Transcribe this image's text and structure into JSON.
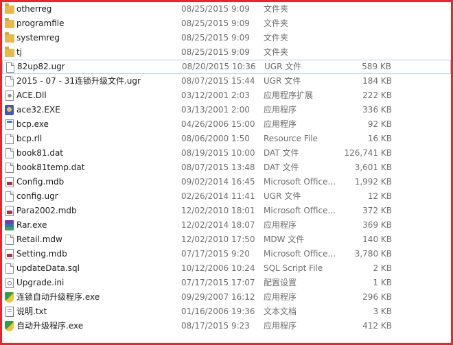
{
  "files": [
    {
      "name": "otherreg",
      "date": "08/25/2015 9:09",
      "type": "文件夹",
      "size": "",
      "icon": "folder-icon",
      "selected": false
    },
    {
      "name": "programfile",
      "date": "08/25/2015 9:09",
      "type": "文件夹",
      "size": "",
      "icon": "folder-icon",
      "selected": false
    },
    {
      "name": "systemreg",
      "date": "08/25/2015 9:09",
      "type": "文件夹",
      "size": "",
      "icon": "folder-icon",
      "selected": false
    },
    {
      "name": "tj",
      "date": "08/25/2015 9:09",
      "type": "文件夹",
      "size": "",
      "icon": "folder-icon",
      "selected": false
    },
    {
      "name": "82up82.ugr",
      "date": "08/20/2015 10:36",
      "type": "UGR 文件",
      "size": "589 KB",
      "icon": "document-icon",
      "selected": true
    },
    {
      "name": "2015 - 07 - 31连锁升级文件.ugr",
      "date": "08/07/2015 15:44",
      "type": "UGR 文件",
      "size": "184 KB",
      "icon": "document-icon",
      "selected": false
    },
    {
      "name": "ACE.Dll",
      "date": "03/12/2001 2:03",
      "type": "应用程序扩展",
      "size": "222 KB",
      "icon": "dll-icon",
      "selected": false
    },
    {
      "name": "ace32.EXE",
      "date": "03/13/2001 2:00",
      "type": "应用程序",
      "size": "336 KB",
      "icon": "app-icon",
      "selected": false
    },
    {
      "name": "bcp.exe",
      "date": "04/26/2006 15:00",
      "type": "应用程序",
      "size": "92 KB",
      "icon": "exe-icon",
      "selected": false
    },
    {
      "name": "bcp.rll",
      "date": "08/06/2000 1:50",
      "type": "Resource File",
      "size": "16 KB",
      "icon": "document-icon",
      "selected": false
    },
    {
      "name": "book81.dat",
      "date": "08/19/2015 10:00",
      "type": "DAT 文件",
      "size": "126,741 KB",
      "icon": "document-icon",
      "selected": false
    },
    {
      "name": "book81temp.dat",
      "date": "08/07/2015 13:48",
      "type": "DAT 文件",
      "size": "3,601 KB",
      "icon": "document-icon",
      "selected": false
    },
    {
      "name": "Config.mdb",
      "date": "09/02/2014 16:45",
      "type": "Microsoft Office...",
      "size": "1,992 KB",
      "icon": "database-icon",
      "selected": false
    },
    {
      "name": "config.ugr",
      "date": "02/26/2014 11:41",
      "type": "UGR 文件",
      "size": "12 KB",
      "icon": "document-icon",
      "selected": false
    },
    {
      "name": "Para2002.mdb",
      "date": "12/02/2010 18:01",
      "type": "Microsoft Office...",
      "size": "372 KB",
      "icon": "database-icon",
      "selected": false
    },
    {
      "name": "Rar.exe",
      "date": "12/02/2014 18:07",
      "type": "应用程序",
      "size": "369 KB",
      "icon": "rar-icon",
      "selected": false
    },
    {
      "name": "Retail.mdw",
      "date": "12/02/2010 17:50",
      "type": "MDW 文件",
      "size": "140 KB",
      "icon": "document-icon",
      "selected": false
    },
    {
      "name": "Setting.mdb",
      "date": "07/17/2015 9:20",
      "type": "Microsoft Office...",
      "size": "3,780 KB",
      "icon": "database-icon",
      "selected": false
    },
    {
      "name": "updateData.sql",
      "date": "10/12/2006 10:24",
      "type": "SQL Script File",
      "size": "2 KB",
      "icon": "document-icon",
      "selected": false
    },
    {
      "name": "Upgrade.ini",
      "date": "07/17/2015 17:07",
      "type": "配置设置",
      "size": "1 KB",
      "icon": "settings-file-icon",
      "selected": false
    },
    {
      "name": "连锁自动升级程序.exe",
      "date": "09/29/2007 16:12",
      "type": "应用程序",
      "size": "296 KB",
      "icon": "shield-app-icon",
      "selected": false
    },
    {
      "name": "说明.txt",
      "date": "01/16/2006 19:36",
      "type": "文本文档",
      "size": "3 KB",
      "icon": "text-file-icon",
      "selected": false
    },
    {
      "name": "自动升级程序.exe",
      "date": "08/17/2015 9:23",
      "type": "应用程序",
      "size": "412 KB",
      "icon": "shield-app-icon",
      "selected": false
    }
  ],
  "colors": {
    "frame": "#e8262b",
    "selection_border": "#99d1ef",
    "folder": "#e8b84a"
  }
}
